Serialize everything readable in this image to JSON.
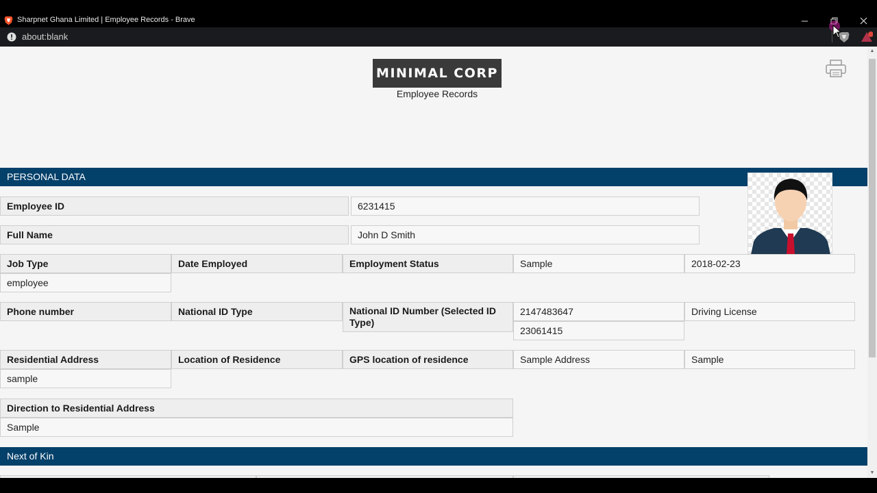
{
  "window": {
    "title": "Sharpnet Ghana Limited | Employee Records - Brave"
  },
  "addressbar": {
    "url": "about:blank"
  },
  "header": {
    "logo_text": "MINIMAL CORP",
    "subtitle": "Employee Records"
  },
  "sections": {
    "personal": "PERSONAL DATA",
    "kin": "Next of Kin"
  },
  "fields": {
    "employee_id": {
      "label": "Employee ID",
      "value": "6231415"
    },
    "full_name": {
      "label": "Full Name",
      "value": "John D Smith"
    },
    "job_type": {
      "label": "Job Type",
      "value": "employee"
    },
    "date_employed": {
      "label": "Date Employed"
    },
    "employment_status": {
      "label": "Employment Status",
      "value": "Sample"
    },
    "date_value": "2018-02-23",
    "phone": {
      "label": "Phone number"
    },
    "national_id_type": {
      "label": "National ID Type"
    },
    "national_id_number": {
      "label": "National ID Number (Selected ID Type)",
      "value1": "2147483647",
      "value2": "23061415"
    },
    "id_type_value": "Driving License",
    "residential_address": {
      "label": "Residential Address",
      "value": "sample"
    },
    "location_of_residence": {
      "label": "Location of Residence"
    },
    "gps_location": {
      "label": "GPS location of residence",
      "value": "Sample Address"
    },
    "gps_value2": "Sample",
    "direction": {
      "label": "Direction to Residential Address",
      "value": "Sample"
    }
  },
  "colors": {
    "section_bar": "#03406a",
    "logo_bg": "#3a3a3a"
  }
}
